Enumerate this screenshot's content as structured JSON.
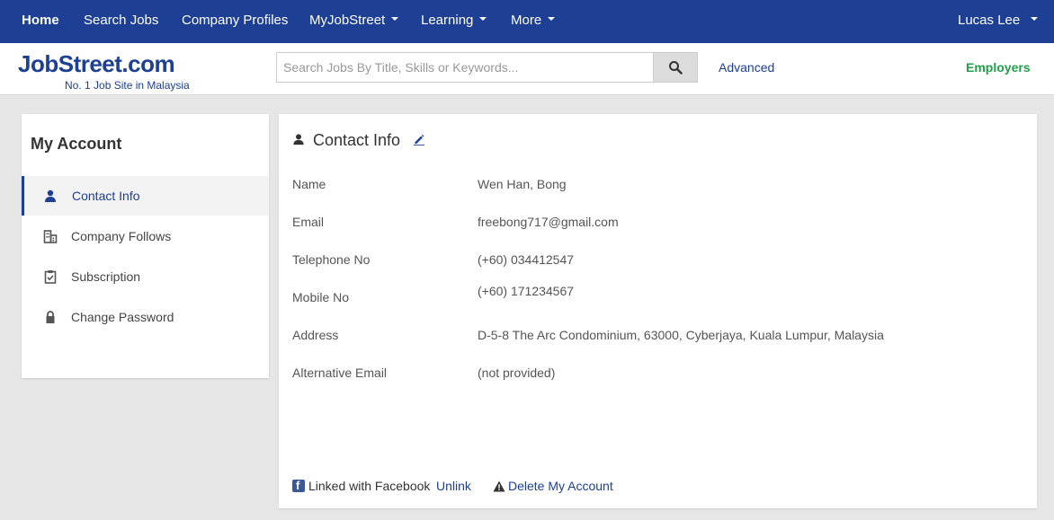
{
  "topnav": {
    "items": [
      {
        "label": "Home"
      },
      {
        "label": "Search Jobs"
      },
      {
        "label": "Company Profiles"
      },
      {
        "label": "MyJobStreet"
      },
      {
        "label": "Learning"
      },
      {
        "label": "More"
      }
    ],
    "user": "Lucas Lee"
  },
  "header": {
    "logo_text": "JobStreet.com",
    "logo_tagline": "No. 1 Job Site in Malaysia",
    "search_placeholder": "Search Jobs By Title, Skills or Keywords...",
    "advanced_label": "Advanced",
    "employers_label": "Employers"
  },
  "sidebar": {
    "title": "My Account",
    "items": [
      {
        "label": "Contact Info",
        "icon": "user-icon",
        "active": true
      },
      {
        "label": "Company Follows",
        "icon": "building-icon"
      },
      {
        "label": "Subscription",
        "icon": "clipboard-check-icon"
      },
      {
        "label": "Change Password",
        "icon": "lock-icon"
      }
    ]
  },
  "contact": {
    "title": "Contact Info",
    "rows": [
      {
        "label": "Name",
        "value": "Wen Han, Bong"
      },
      {
        "label": "Email",
        "value": "freebong717@gmail.com"
      },
      {
        "label": "Telephone No",
        "value": "(+60) 034412547"
      },
      {
        "label": "Mobile No",
        "value": "(+60) 171234567"
      },
      {
        "label": "Address",
        "value": "D-5-8 The Arc Condominium, 63000, Cyberjaya, Kuala Lumpur, Malaysia"
      },
      {
        "label": "Alternative Email",
        "value": "(not provided)"
      }
    ]
  },
  "footer": {
    "facebook_text": "Linked with Facebook",
    "unlink_label": "Unlink",
    "delete_label": "Delete My Account"
  },
  "colors": {
    "brand_blue": "#1d3f94",
    "employers_green": "#21a04a",
    "page_bg": "#e6e6e6"
  }
}
